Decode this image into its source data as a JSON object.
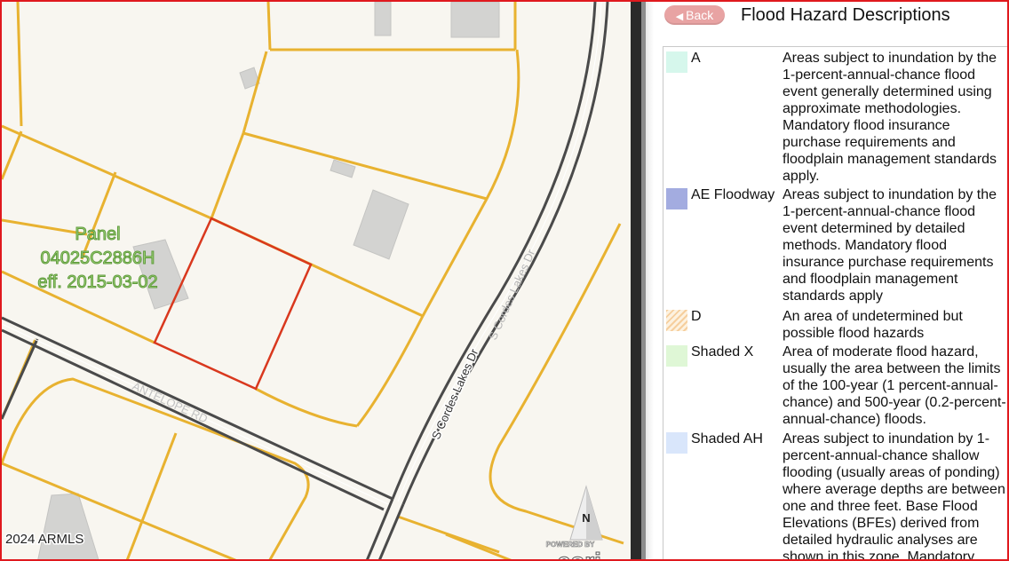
{
  "map": {
    "panel_label": {
      "line1": "Panel",
      "line2": "04025C2886H",
      "line3": "eff. 2015-03-02"
    },
    "street_labels": {
      "main": "S Cordes Lakes Dr",
      "faded": "S Cordes Lakes Dr",
      "secondary": "ANTELOPE RD"
    },
    "copyright": "2024 ARMLS",
    "north_label": "N",
    "attribution": {
      "powered_by": "POWERED BY",
      "brand": "esri"
    },
    "colors": {
      "parcel_line": "#e8b230",
      "selected_parcel": "#d9381e",
      "background": "#f8f6f0",
      "road": "#4a4a4a"
    }
  },
  "panel": {
    "back_label": "Back",
    "back_icon": "arrow-left-icon",
    "title": "Flood Hazard Descriptions",
    "legend": [
      {
        "code": "A",
        "color": "#d6f7ec",
        "description": "Areas subject to inundation by the 1-percent-annual-chance flood event generally determined using approximate methodologies. Mandatory flood insurance purchase requirements and floodplain management standards apply."
      },
      {
        "code": "AE Floodway",
        "color": "#a3ace0",
        "description": "Areas subject to inundation by the 1-percent-annual-chance flood event determined by detailed methods. Mandatory flood insurance purchase requirements and floodplain management standards apply"
      },
      {
        "code": "D",
        "color": "hatched-orange",
        "description": "An area of undetermined but possible flood hazards"
      },
      {
        "code": "Shaded X",
        "color": "#dff7d6",
        "description": "Area of moderate flood hazard, usually the area between the limits of the 100-year (1 percent-annual-chance) and 500-year (0.2-percent-annual-chance) floods."
      },
      {
        "code": "Shaded AH",
        "color": "#d9e6fb",
        "description": "Areas subject to inundation by 1-percent-annual-chance shallow flooding (usually areas of ponding) where average depths are between one and three feet. Base Flood Elevations (BFEs) derived from detailed hydraulic analyses are shown in this zone. Mandatory"
      }
    ]
  }
}
